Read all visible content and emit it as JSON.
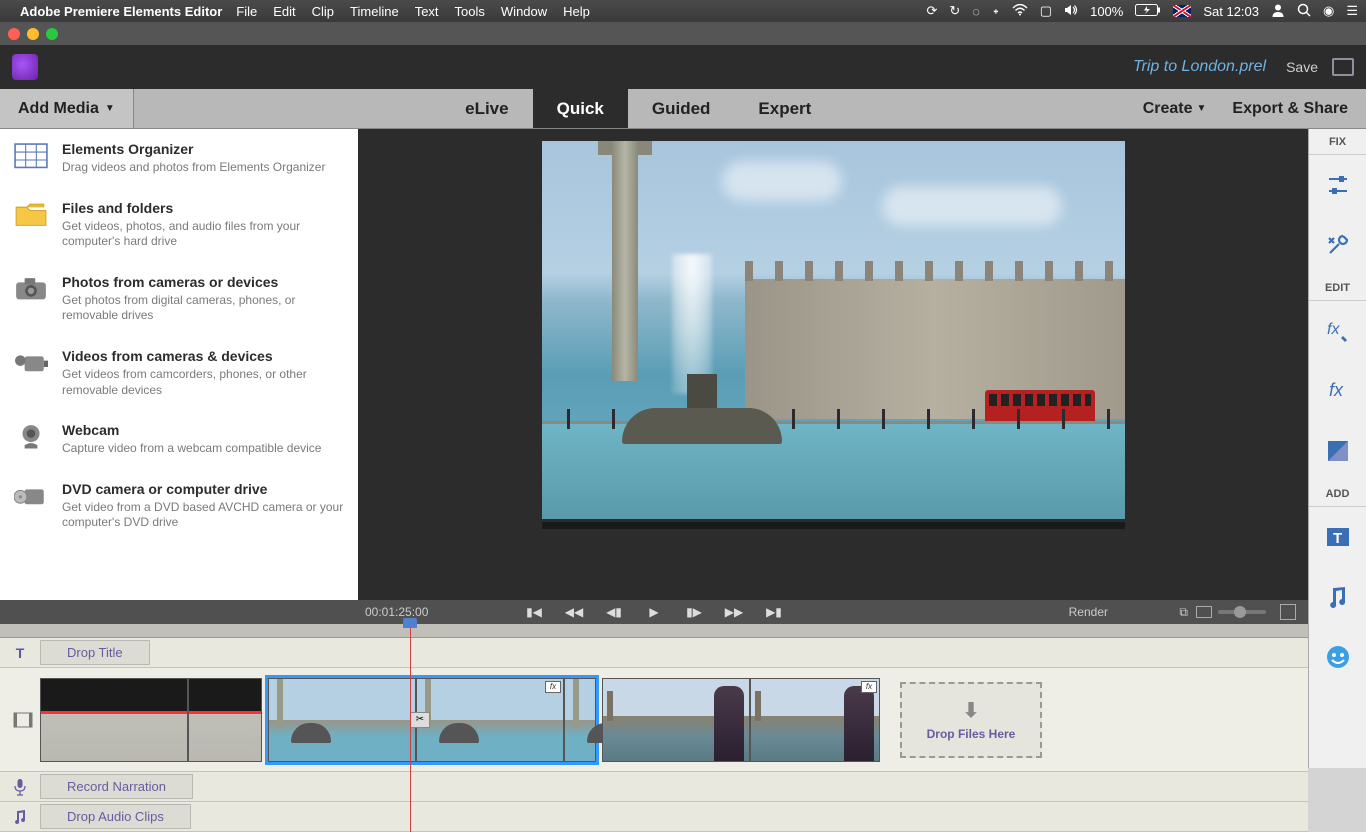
{
  "menubar": {
    "app": "Adobe Premiere Elements Editor",
    "items": [
      "File",
      "Edit",
      "Clip",
      "Timeline",
      "Text",
      "Tools",
      "Window",
      "Help"
    ],
    "battery": "100%",
    "clock": "Sat 12:03"
  },
  "titlebar": {
    "project": "Trip to London.prel",
    "save": "Save"
  },
  "modebar": {
    "add_media": "Add Media",
    "tabs": {
      "elive": "eLive",
      "quick": "Quick",
      "guided": "Guided",
      "expert": "Expert"
    },
    "create": "Create",
    "export": "Export & Share"
  },
  "media_sources": [
    {
      "title": "Elements Organizer",
      "desc": "Drag videos and photos from Elements Organizer",
      "icon": "organizer"
    },
    {
      "title": "Files and folders",
      "desc": "Get videos, photos, and audio files from your computer's hard drive",
      "icon": "folder"
    },
    {
      "title": "Photos from cameras or devices",
      "desc": "Get photos from digital cameras, phones, or removable drives",
      "icon": "camera"
    },
    {
      "title": "Videos from cameras & devices",
      "desc": "Get videos from camcorders, phones, or other removable devices",
      "icon": "camcorder"
    },
    {
      "title": "Webcam",
      "desc": "Capture video from a webcam compatible device",
      "icon": "webcam"
    },
    {
      "title": "DVD camera or computer drive",
      "desc": "Get video from a DVD based AVCHD camera or your computer's DVD drive",
      "icon": "dvd"
    }
  ],
  "preview": {
    "timecode": "00:01:25:00",
    "render": "Render"
  },
  "tracks": {
    "title_drop": "Drop Title",
    "narration": "Record Narration",
    "audio": "Drop Audio Clips",
    "drop_files": "Drop Files Here"
  },
  "right_panel": {
    "fix": "FIX",
    "edit": "EDIT",
    "add": "ADD"
  }
}
